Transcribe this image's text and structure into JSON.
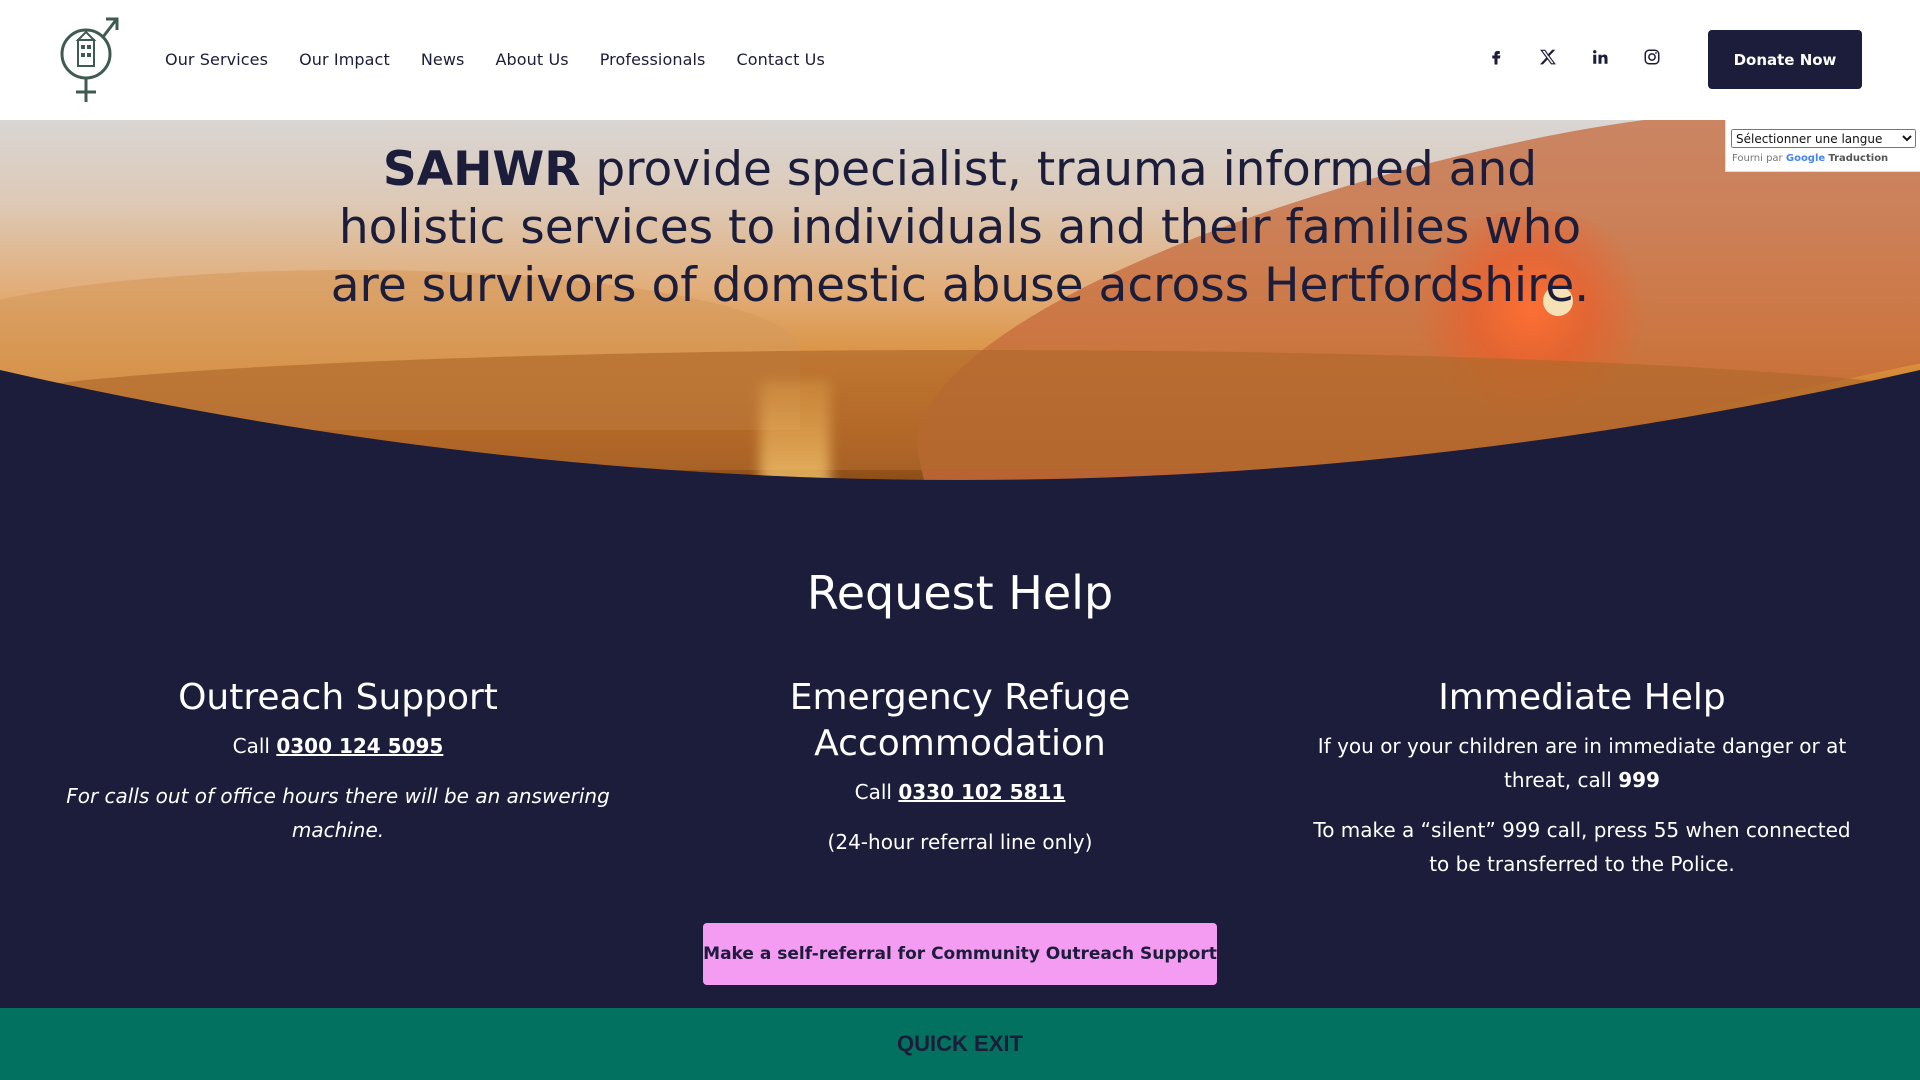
{
  "nav": {
    "items": [
      {
        "label": "Our Services"
      },
      {
        "label": "Our Impact"
      },
      {
        "label": "News"
      },
      {
        "label": "About Us"
      },
      {
        "label": "Professionals"
      },
      {
        "label": "Contact Us"
      }
    ]
  },
  "socials": [
    "facebook-icon",
    "x-icon",
    "linkedin-icon",
    "instagram-icon"
  ],
  "header": {
    "donate_label": "Donate Now"
  },
  "hero": {
    "org_name": "SAHWR",
    "statement": " provide specialist, trauma informed and holistic services to individuals and their families who are survivors of domestic abuse across Hertfordshire."
  },
  "translate": {
    "selected": "Sélectionner une langue",
    "powered_by": "Fourni par",
    "google": "Google",
    "translation": "Traduction"
  },
  "request_help": {
    "title": "Request Help",
    "outreach": {
      "heading": "Outreach Support",
      "call_prefix": "Call",
      "phone": "0300 124 5095",
      "note": "For calls out of office hours there will be an answering machine."
    },
    "refuge": {
      "heading": "Emergency Refuge Accommodation",
      "call_prefix": "Call",
      "phone": "0330 102 5811",
      "note": "(24-hour referral line only)"
    },
    "immediate": {
      "heading": "Immediate Help",
      "line1": "If you or your children are in immediate danger or at threat, call",
      "emergency_number": "999",
      "line2": "To make a “silent” 999 call, press 55 when connected to be transferred to the Police."
    },
    "referral_button": "Make a self-referral for Community Outreach Support"
  },
  "quick_exit": {
    "label": "QUICK EXIT"
  },
  "colors": {
    "navy": "#1b1d3b",
    "pink": "#f49bf2",
    "green": "#037160",
    "white": "#ffffff"
  }
}
